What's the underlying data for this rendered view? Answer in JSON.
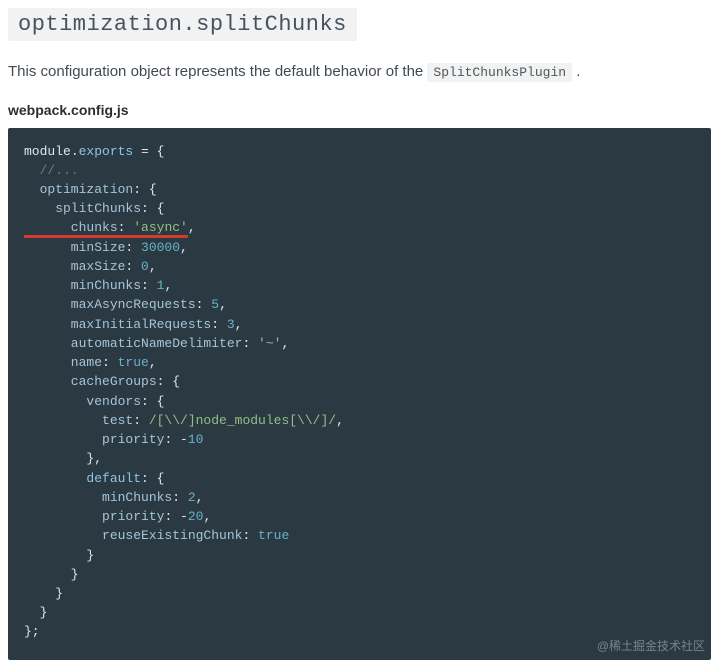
{
  "heading": "optimization.splitChunks",
  "intro_pre": "This configuration object represents the default behavior of the ",
  "intro_code": "SplitChunksPlugin",
  "intro_post": " .",
  "filename": "webpack.config.js",
  "code": {
    "l1a": "module",
    "l1b": ".",
    "l1c": "exports",
    "l1d": " = {",
    "l2": "  //...",
    "l3a": "  optimization",
    "l3b": ": {",
    "l4a": "    splitChunks",
    "l4b": ": {",
    "l5a": "      chunks",
    "l5b": ": ",
    "l5c": "'async'",
    "l5d": ",",
    "l6a": "      minSize",
    "l6b": ": ",
    "l6c": "30000",
    "l6d": ",",
    "l7a": "      maxSize",
    "l7b": ": ",
    "l7c": "0",
    "l7d": ",",
    "l8a": "      minChunks",
    "l8b": ": ",
    "l8c": "1",
    "l8d": ",",
    "l9a": "      maxAsyncRequests",
    "l9b": ": ",
    "l9c": "5",
    "l9d": ",",
    "l10a": "      maxInitialRequests",
    "l10b": ": ",
    "l10c": "3",
    "l10d": ",",
    "l11a": "      automaticNameDelimiter",
    "l11b": ": ",
    "l11c": "'~'",
    "l11d": ",",
    "l12a": "      name",
    "l12b": ": ",
    "l12c": "true",
    "l12d": ",",
    "l13a": "      cacheGroups",
    "l13b": ": {",
    "l14a": "        vendors",
    "l14b": ": {",
    "l15a": "          test",
    "l15b": ": ",
    "l15c": "/[\\\\/]node_modules[\\\\/]/",
    "l15d": ",",
    "l16a": "          priority",
    "l16b": ": -",
    "l16c": "10",
    "l17": "        },",
    "l18a": "        default",
    "l18b": ": {",
    "l19a": "          minChunks",
    "l19b": ": ",
    "l19c": "2",
    "l19d": ",",
    "l20a": "          priority",
    "l20b": ": -",
    "l20c": "20",
    "l20d": ",",
    "l21a": "          reuseExistingChunk",
    "l21b": ": ",
    "l21c": "true",
    "l22": "        }",
    "l23": "      }",
    "l24": "    }",
    "l25": "  }",
    "l26": "};"
  },
  "watermark": "@稀土掘金技术社区"
}
